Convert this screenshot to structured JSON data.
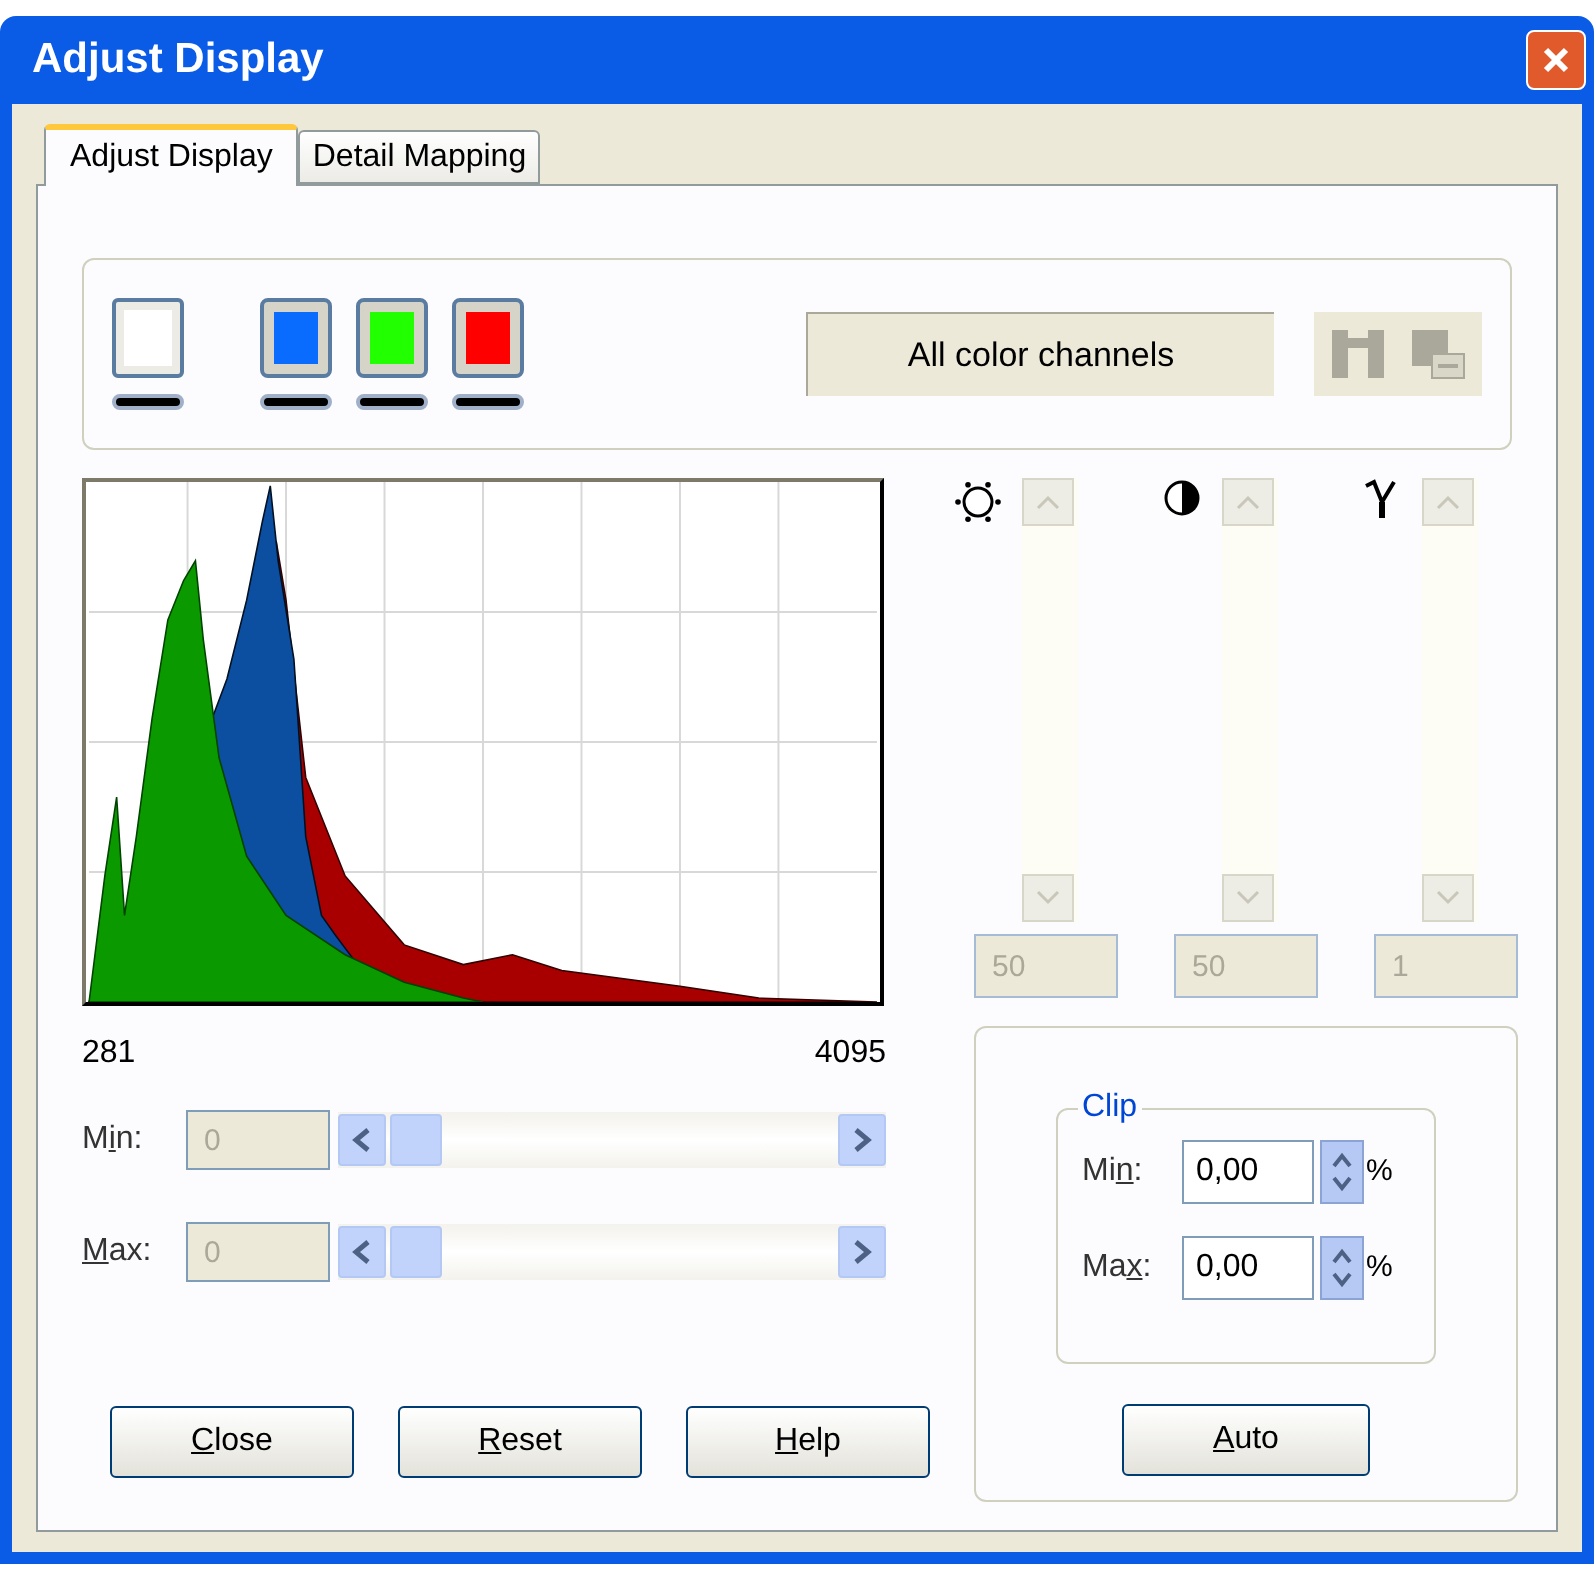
{
  "window": {
    "title": "Adjust Display"
  },
  "tabs": [
    {
      "label": "Adjust Display",
      "selected": true
    },
    {
      "label": "Detail Mapping",
      "selected": false
    }
  ],
  "channels": [
    {
      "kind": "all",
      "color": "#ffffff"
    },
    {
      "kind": "single",
      "color": "#0a6cff"
    },
    {
      "kind": "single",
      "color": "#22ff00"
    },
    {
      "kind": "single",
      "color": "#ff0000"
    }
  ],
  "channel_label": "All color channels",
  "channel_tools": [
    {
      "kind": "link",
      "disabled": true
    },
    {
      "kind": "copy",
      "disabled": true
    }
  ],
  "histogram": {
    "min_label": "281",
    "max_label": "4095"
  },
  "range": [
    {
      "pre": "M",
      "key": "i",
      "post": "n:",
      "value": "0",
      "disabled": true
    },
    {
      "key": "M",
      "post": "ax:",
      "value": "0",
      "disabled": true
    }
  ],
  "adjusters": [
    {
      "kind": "brightness",
      "value": "50",
      "disabled": true
    },
    {
      "kind": "contrast",
      "value": "50",
      "disabled": true
    },
    {
      "kind": "gamma",
      "value": "1",
      "disabled": true
    }
  ],
  "clip": {
    "title": "Clip",
    "fields": [
      {
        "pre": "Mi",
        "key": "n",
        "post": ":",
        "value": "0,00",
        "unit": "%"
      },
      {
        "pre": "Ma",
        "key": "x",
        "post": ":",
        "value": "0,00",
        "unit": "%"
      }
    ]
  },
  "buttons": [
    {
      "key": "C",
      "post": "lose"
    },
    {
      "key": "R",
      "post": "eset"
    },
    {
      "key": "H",
      "post": "elp"
    }
  ],
  "auto_button": {
    "key": "A",
    "post": "uto"
  }
}
